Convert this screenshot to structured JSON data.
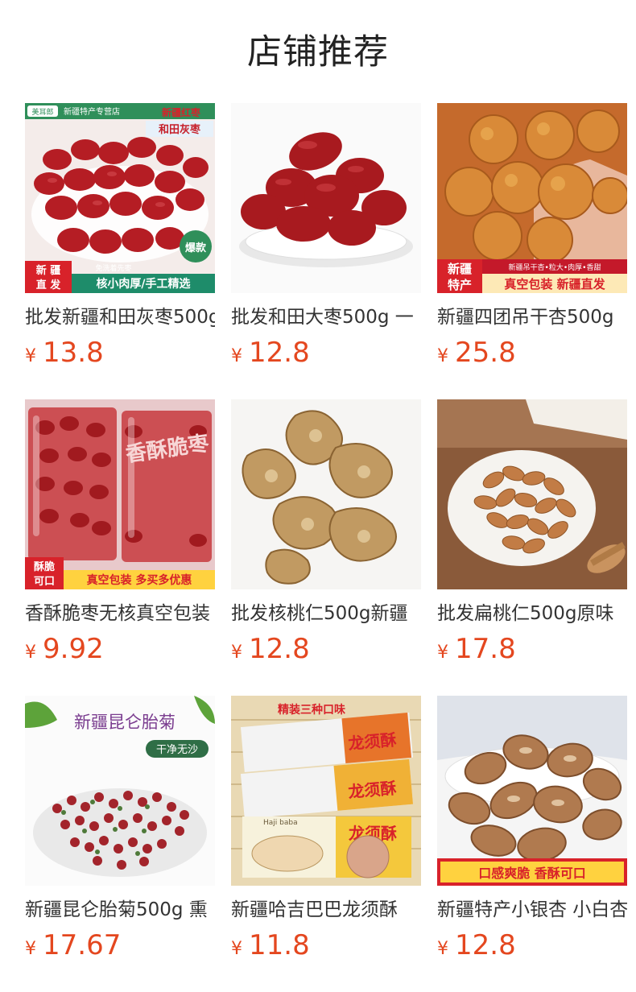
{
  "section": {
    "title": "店铺推荐"
  },
  "colors": {
    "price": "#e4471f",
    "title": "#222222",
    "name": "#333333"
  },
  "products": [
    {
      "name": "批发新疆和田灰枣500g",
      "currency": "¥",
      "price": "13.8",
      "icon": "red-dates-image",
      "badges": {
        "brand": "美耳郎",
        "store": "新疆特产专营店",
        "title1": "新疆红枣",
        "title2": "和田灰枣",
        "hot": "爆款",
        "corner1": "新 疆",
        "corner2": "直 发",
        "small": "免洗着先枣",
        "bar": "核小肉厚/手工精选"
      }
    },
    {
      "name": "批发和田大枣500g 一",
      "currency": "¥",
      "price": "12.8",
      "icon": "big-jujube-image"
    },
    {
      "name": "新疆四团吊干杏500g",
      "currency": "¥",
      "price": "25.8",
      "icon": "dried-apricot-image",
      "badges": {
        "corner1": "新疆",
        "corner2": "特产",
        "small": "新疆吊干杏•粒大•肉厚•香甜",
        "bar": "真空包装 新疆直发"
      }
    },
    {
      "name": "香酥脆枣无核真空包装",
      "currency": "¥",
      "price": "9.92",
      "icon": "crispy-dates-image",
      "badges": {
        "corner1": "酥脆",
        "corner2": "可口",
        "bar": "真空包装 多买多优惠",
        "pack": "香酥脆枣"
      }
    },
    {
      "name": "批发核桃仁500g新疆",
      "currency": "¥",
      "price": "12.8",
      "icon": "walnut-kernel-image"
    },
    {
      "name": "批发扁桃仁500g原味",
      "currency": "¥",
      "price": "17.8",
      "icon": "almond-image"
    },
    {
      "name": "新疆昆仑胎菊500g 熏",
      "currency": "¥",
      "price": "17.67",
      "icon": "chrysanthemum-tea-image",
      "badges": {
        "title1": "新疆昆仑胎菊",
        "tag": "干净无沙"
      }
    },
    {
      "name": "新疆哈吉巴巴龙须酥",
      "currency": "¥",
      "price": "11.8",
      "icon": "dragon-beard-candy-image",
      "badges": {
        "title1": "精装三种口味",
        "box": "龙须酥",
        "brand": "Haji baba"
      }
    },
    {
      "name": "新疆特产小银杏 小白杏",
      "currency": "¥",
      "price": "12.8",
      "icon": "apricot-kernel-image",
      "badges": {
        "bar": "口感爽脆 香酥可口"
      }
    }
  ]
}
